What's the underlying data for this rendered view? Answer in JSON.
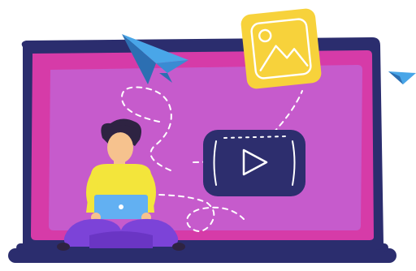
{
  "illustration": {
    "icons": {
      "video": "play-icon",
      "image": "image-icon",
      "paper_plane": "paper-plane-icon",
      "laptop": "laptop-icon",
      "person": "person-icon"
    },
    "colors": {
      "frame_navy": "#2B2D6E",
      "screen_pink": "#D63BA8",
      "screen_inner": "#C75BCC",
      "play_card_bg": "#2D2E6E",
      "image_card_yellow": "#F7D23B",
      "plane_light": "#49A6E8",
      "plane_dark": "#2C6FB2",
      "shirt": "#F3E53B",
      "pants": "#7C43D8",
      "skin": "#F6C28E",
      "hair": "#2E2342",
      "laptop_small": "#62B0F2"
    }
  }
}
